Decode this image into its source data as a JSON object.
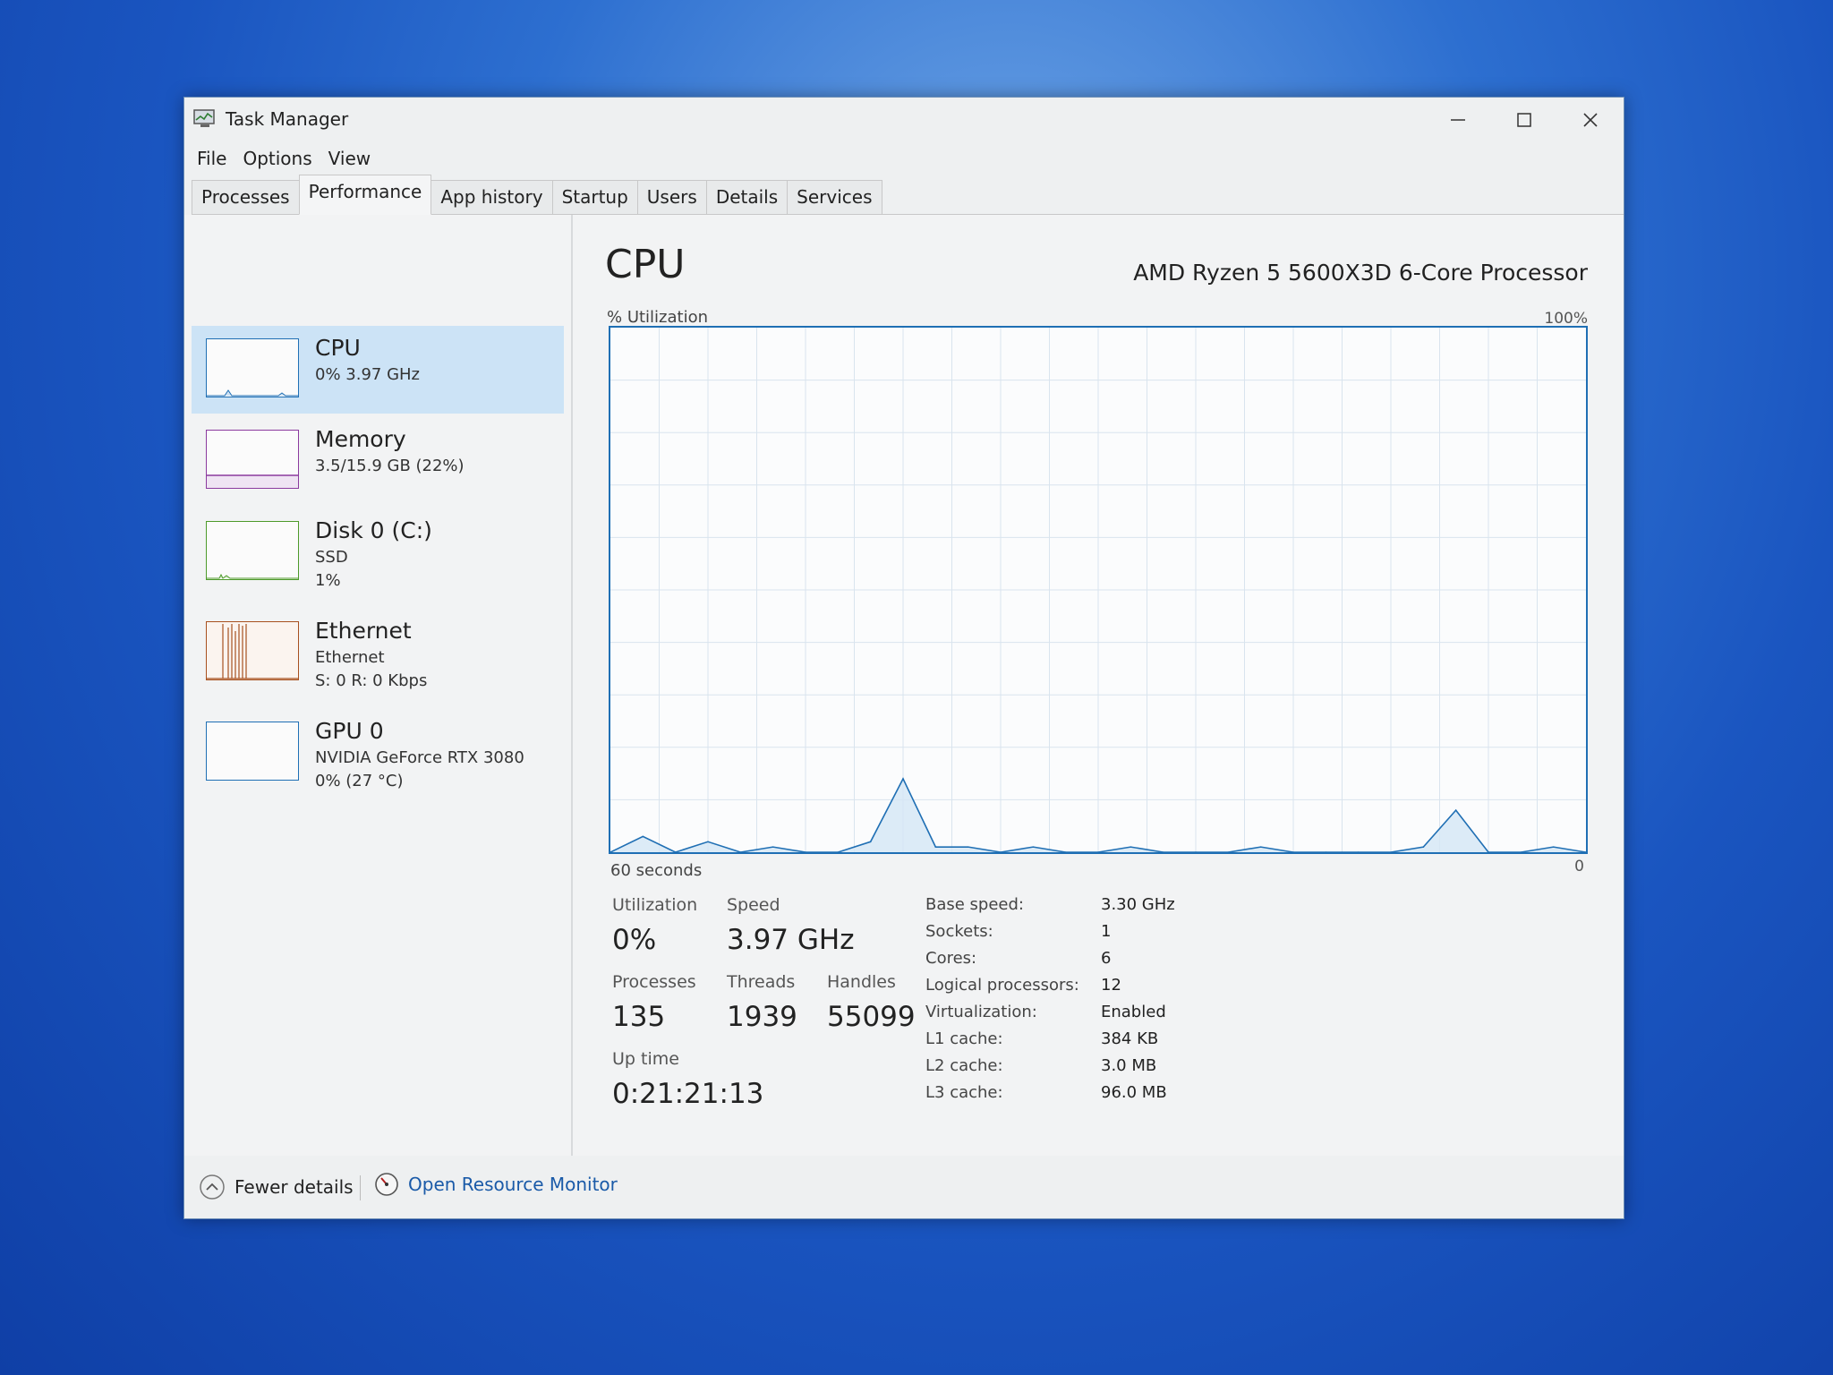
{
  "window": {
    "title": "Task Manager"
  },
  "menu": [
    "File",
    "Options",
    "View"
  ],
  "tabs": [
    "Processes",
    "Performance",
    "App history",
    "Startup",
    "Users",
    "Details",
    "Services"
  ],
  "sidebar": [
    {
      "name": "CPU",
      "line1": "0%  3.97 GHz",
      "line2": ""
    },
    {
      "name": "Memory",
      "line1": "3.5/15.9 GB (22%)",
      "line2": ""
    },
    {
      "name": "Disk 0 (C:)",
      "line1": "SSD",
      "line2": "1%"
    },
    {
      "name": "Ethernet",
      "line1": "Ethernet",
      "line2": "S: 0  R: 0 Kbps"
    },
    {
      "name": "GPU 0",
      "line1": "NVIDIA GeForce RTX 3080",
      "line2": "0%  (27 °C)"
    }
  ],
  "main": {
    "title": "CPU",
    "processor": "AMD Ryzen 5 5600X3D 6-Core Processor",
    "util_label": "% Utilization",
    "max_label": "100%",
    "time_label": "60 seconds",
    "zero_label": "0"
  },
  "stats": {
    "utilization_label": "Utilization",
    "utilization": "0%",
    "speed_label": "Speed",
    "speed": "3.97 GHz",
    "processes_label": "Processes",
    "processes": "135",
    "threads_label": "Threads",
    "threads": "1939",
    "handles_label": "Handles",
    "handles": "55099",
    "uptime_label": "Up time",
    "uptime": "0:21:21:13"
  },
  "specs": [
    {
      "label": "Base speed:",
      "value": "3.30 GHz"
    },
    {
      "label": "Sockets:",
      "value": "1"
    },
    {
      "label": "Cores:",
      "value": "6"
    },
    {
      "label": "Logical processors:",
      "value": "12"
    },
    {
      "label": "Virtualization:",
      "value": "Enabled"
    },
    {
      "label": "L1 cache:",
      "value": "384 KB"
    },
    {
      "label": "L2 cache:",
      "value": "3.0 MB"
    },
    {
      "label": "L3 cache:",
      "value": "96.0 MB"
    }
  ],
  "footer": {
    "fewer_details": "Fewer details",
    "resource_monitor": "Open Resource Monitor"
  },
  "colors": {
    "cpu": "#1f6fb4",
    "memory": "#8b3a9e",
    "disk": "#4d9a2a",
    "ethernet": "#a7501f",
    "gpu": "#1f6fb4",
    "link": "#1a5aa8"
  },
  "chart_data": {
    "type": "line",
    "title": "CPU",
    "xlabel": "60 seconds",
    "ylabel": "% Utilization",
    "ylim": [
      0,
      100
    ],
    "x": [
      0,
      2,
      4,
      6,
      8,
      10,
      12,
      14,
      16,
      18,
      20,
      22,
      24,
      26,
      28,
      30,
      32,
      34,
      36,
      38,
      40,
      42,
      44,
      46,
      48,
      50,
      52,
      54,
      56,
      58,
      60
    ],
    "series": [
      {
        "values": [
          0,
          3,
          0,
          2,
          0,
          1,
          0,
          0,
          2,
          14,
          1,
          1,
          0,
          1,
          0,
          0,
          1,
          0,
          0,
          0,
          1,
          0,
          0,
          0,
          0,
          1,
          8,
          0,
          0,
          1,
          0
        ]
      }
    ]
  }
}
